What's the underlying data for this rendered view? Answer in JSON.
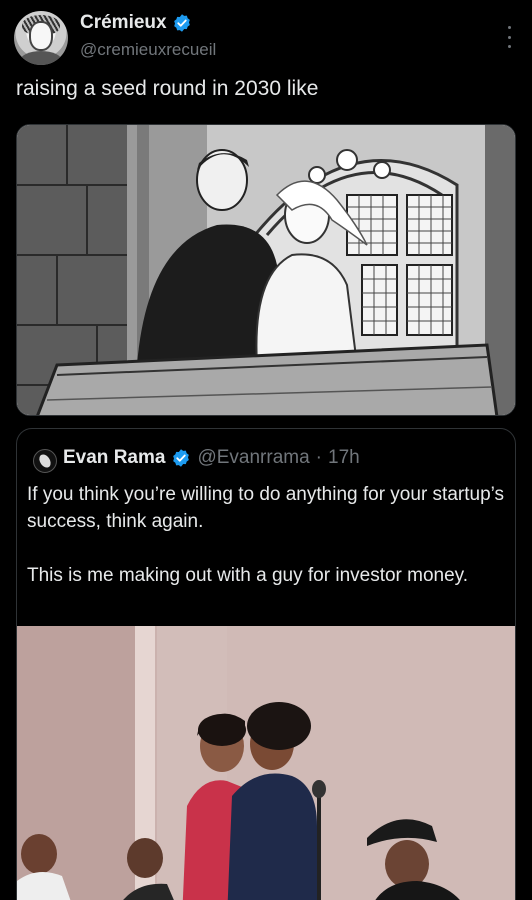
{
  "tweet": {
    "author": {
      "display_name": "Crémieux",
      "handle": "@cremieuxrecueil",
      "verified": true,
      "avatar_icon": "cartoon-portrait-avatar"
    },
    "text": "raising a seed round in 2030 like",
    "media": {
      "kind": "manga-panel-illustration"
    }
  },
  "quoted_tweet": {
    "author": {
      "display_name": "Evan Rama",
      "handle": "@Evanrrama",
      "verified": true,
      "avatar_icon": "profile-avatar"
    },
    "separator": "·",
    "time": "17h",
    "text": "If you think you’re willing to do anything for your startup’s success, think again.\n\nThis is me making out with a guy for investor money.",
    "media": {
      "kind": "event-photo"
    }
  },
  "colors": {
    "background": "#000000",
    "text_primary": "#e7e9ea",
    "text_secondary": "#71767b",
    "verified_blue": "#1d9bf0",
    "border": "#2f3336"
  }
}
